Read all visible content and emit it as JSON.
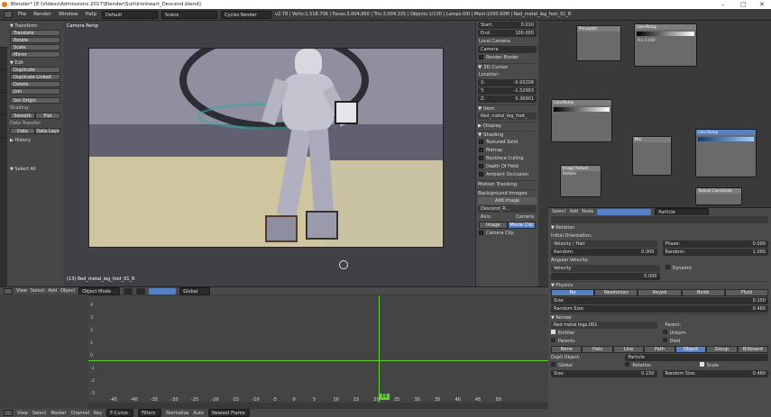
{
  "window": {
    "title": "Blender* [E:\\Videos\\Admissions 2017\\Blender\\Suit\\Ironheart_Descend.blend]",
    "controls": [
      "–",
      "□",
      "✕"
    ]
  },
  "info": {
    "menus": [
      "File",
      "Render",
      "Window",
      "Help"
    ],
    "layout": "Default",
    "scene": "Scene",
    "engine": "Cycles Render",
    "stats": "v2.78 | Verts:1,518,706 | Faces:3,004,860 | Tris:3,004,335 | Objects:1/130 | Lamps:0/0 | Mem:1000.60M | Red_metal_leg_foot_01_R"
  },
  "toolshelf": {
    "transform_header": "▼ Transform",
    "transform": [
      "Translate",
      "Rotate",
      "Scale",
      "Mirror"
    ],
    "edit_header": "▼ Edit",
    "edit": [
      "Duplicate",
      "Duplicate Linked",
      "Delete",
      "Join"
    ],
    "set_origin": "Set Origin",
    "shading_label": "Shading:",
    "smooth": "Smooth",
    "flat": "Flat",
    "data_transfer_label": "Data Transfer:",
    "data": "Data",
    "data_layo": "Data Layo",
    "history": "▶ History",
    "select_all": "▼ Select All"
  },
  "viewport": {
    "label": "Camera Persp",
    "object_label": "(13) Red_metal_leg_foot_01_R",
    "header": [
      "View",
      "Select",
      "Add",
      "Object"
    ],
    "mode": "Object Mode",
    "orientation": "Global"
  },
  "npanel": {
    "start_label": "Start:",
    "start_value": "0.010",
    "end_label": "End:",
    "end_value": "100.000",
    "local_camera": "Local Camera:",
    "camera": "Camera",
    "render_border": "Render Border",
    "cursor_header": "▼ 3D Cursor",
    "location_label": "Location:",
    "x_label": "X:",
    "x_value": "-0.93206",
    "y_label": "Y:",
    "y_value": "-1.52993",
    "z_label": "Z:",
    "z_value": "0.36901",
    "item_header": "▼ Item",
    "item_name": "Red_metal_leg_foot_",
    "display_header": "▶ Display",
    "shading_header": "▼ Shading",
    "shading_opts": [
      "Textured Solid",
      "Matcap",
      "Backface Culling",
      "Depth Of Field",
      "Ambient Occlusion"
    ],
    "motion_tracking": "Motion Tracking",
    "background_images": "Background Images",
    "add_image": "Add Image",
    "bg_name": "Descend_R...",
    "axis_label": "Axis:",
    "axis_value": "Camera",
    "image_btn": "Image",
    "movie_clip_btn": "Movie Clip",
    "camera_clip": "Camera Clip"
  },
  "nodes": {
    "node_titles": [
      "Principled",
      "ColorRamp",
      "ColorRamp",
      "ColorRamp",
      "Mix",
      "Image Texture",
      "Texture Coordinate"
    ],
    "rgb_label": "RGB",
    "linear_label": "Linear",
    "pos_label": "Pos",
    "pos_value": "0.000",
    "particle_label": "Particle",
    "color_label": "Color",
    "alpha_label": "Alpha",
    "fac_label": "Fac",
    "mix_label": "Mix",
    "clamp_label": "Clamp"
  },
  "props": {
    "header_menus": [
      "Select",
      "Add",
      "Node"
    ],
    "particle_name": "Particle",
    "rotation_header": "▼ Rotation",
    "initial_orientation": "Initial Orientation:",
    "orientation_value": "Velocity / Hair",
    "phase_label": "Phase:",
    "phase_value": "0.000",
    "random_label": "Random:",
    "random_value": "0.000",
    "random_value2": "1.000",
    "angular_velocity": "Angular Velocity:",
    "velocity_value": "Velocity",
    "ang_value": "0.000",
    "dynamic_label": "Dynamic",
    "physics_header": "▼ Physics",
    "physics_buttons": [
      "No",
      "Newtonian",
      "Keyed",
      "Boids",
      "Fluid"
    ],
    "size_label": "Size:",
    "size_value": "0.150",
    "random_size_label": "Random Size:",
    "random_size_value": "0.460",
    "render_header": "▼ Render",
    "material_value": "Red metal legs.001",
    "parent_label": "Parent:",
    "emitter": "Emitter",
    "unborn": "Unborn",
    "parents": "Parents",
    "died": "Died",
    "render_buttons": [
      "None",
      "Halo",
      "Line",
      "Path",
      "Object",
      "Group",
      "Billboard"
    ],
    "dupli_object_label": "Dupli Object:",
    "dupli_value": "Particle",
    "global": "Global",
    "rotation_chk": "Rotation",
    "scale_chk": "Scale",
    "size2_label": "Size:",
    "size2_value": "0.150",
    "random_size2_label": "Random Size:",
    "random_size2_value": "0.460"
  },
  "timeline": {
    "header": [
      "View",
      "Select",
      "Marker",
      "Channel",
      "Key"
    ],
    "fcurve": "F-Curve",
    "filters": "Filters",
    "normalize": "Normalize",
    "auto": "Auto",
    "nearest_frame": "Nearest Frame",
    "current_frame": "13",
    "ticks": [
      "-45",
      "-40",
      "-35",
      "-30",
      "-25",
      "-20",
      "-15",
      "-10",
      "-5",
      "0",
      "5",
      "10",
      "15",
      "20",
      "25",
      "30",
      "35",
      "40",
      "45",
      "50"
    ],
    "y_ticks": [
      "4",
      "3",
      "2",
      "1",
      "0",
      "-1",
      "-2",
      "-3"
    ]
  },
  "colors": {
    "accent": "#5680c2",
    "frame_line": "#60d030"
  }
}
